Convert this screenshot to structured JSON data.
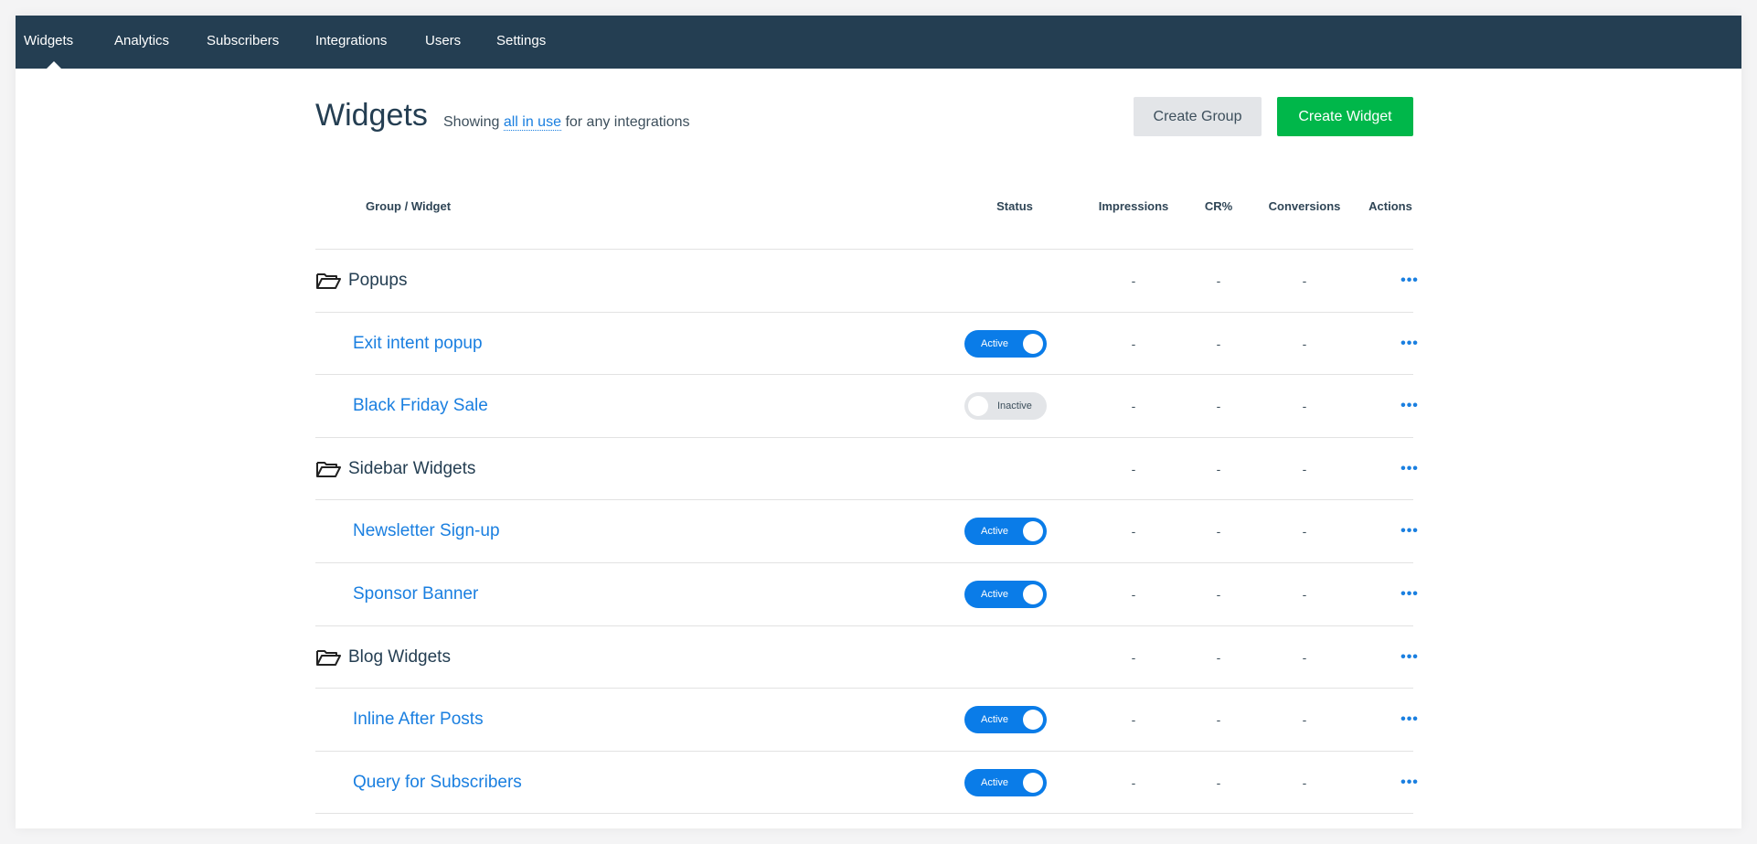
{
  "nav": {
    "items": [
      {
        "label": "Widgets",
        "active": true
      },
      {
        "label": "Analytics"
      },
      {
        "label": "Subscribers"
      },
      {
        "label": "Integrations"
      },
      {
        "label": "Users"
      },
      {
        "label": "Settings"
      }
    ]
  },
  "header": {
    "title": "Widgets",
    "subtitle_prefix": "Showing",
    "filter_link": "all in use",
    "subtitle_suffix": "for any integrations",
    "create_group_label": "Create Group",
    "create_widget_label": "Create Widget"
  },
  "table": {
    "columns": [
      "Group / Widget",
      "Status",
      "Impressions",
      "CR%",
      "Conversions",
      "Actions"
    ],
    "rows": [
      {
        "type": "group",
        "name": "Popups",
        "impressions": "-",
        "cr": "-",
        "conversions": "-",
        "actions_icon": "more-icon"
      },
      {
        "type": "widget",
        "name": "Exit intent popup",
        "status": "Active",
        "impressions": "-",
        "cr": "-",
        "conversions": "-"
      },
      {
        "type": "widget",
        "name": "Black Friday Sale",
        "status": "Inactive",
        "impressions": "-",
        "cr": "-",
        "conversions": "-"
      },
      {
        "type": "group",
        "name": "Sidebar Widgets",
        "impressions": "-",
        "cr": "-",
        "conversions": "-"
      },
      {
        "type": "widget",
        "name": "Newsletter Sign-up",
        "status": "Active",
        "impressions": "-",
        "cr": "-",
        "conversions": "-"
      },
      {
        "type": "widget",
        "name": "Sponsor Banner",
        "status": "Active",
        "impressions": "-",
        "cr": "-",
        "conversions": "-"
      },
      {
        "type": "group",
        "name": "Blog Widgets",
        "impressions": "-",
        "cr": "-",
        "conversions": "-"
      },
      {
        "type": "widget",
        "name": "Inline After Posts",
        "status": "Active",
        "impressions": "-",
        "cr": "-",
        "conversions": "-"
      },
      {
        "type": "widget",
        "name": "Query for Subscribers",
        "status": "Active",
        "impressions": "-",
        "cr": "-",
        "conversions": "-"
      }
    ],
    "actions_glyph": "•••"
  },
  "colors": {
    "nav_bg": "#243e52",
    "link": "#1a7fe0",
    "primary_button": "#00b74a",
    "toggle_active": "#0a7ce8",
    "toggle_inactive": "#e3e5e8"
  }
}
